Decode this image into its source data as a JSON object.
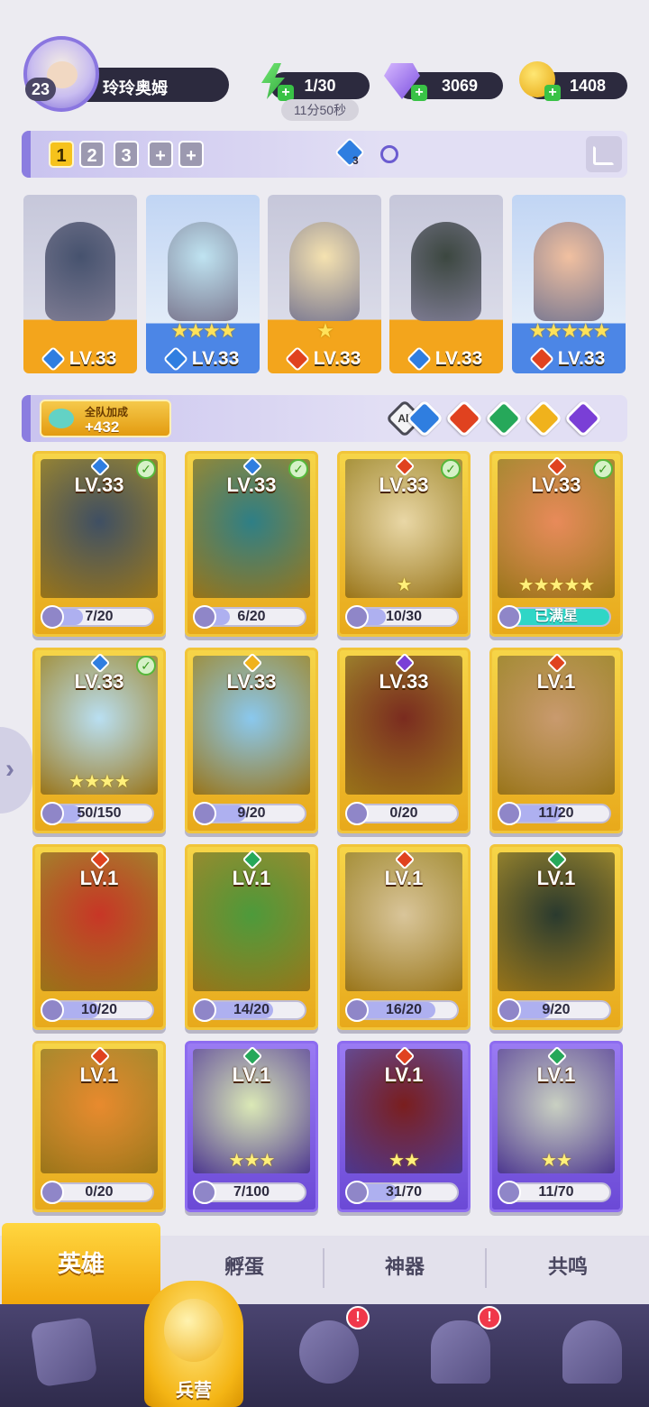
{
  "player": {
    "level": "23",
    "name": "玲玲奥姆"
  },
  "resources": {
    "energy": "1/30",
    "energy_timer": "11分50秒",
    "gems": "3069",
    "coins": "1408"
  },
  "team_tabs": [
    "1",
    "2",
    "3",
    "+",
    "+"
  ],
  "team_gem_count": "3",
  "team": [
    {
      "level": "LV.33",
      "stars": "",
      "element": "water",
      "rarity": "legend"
    },
    {
      "level": "LV.33",
      "stars": "★★★★",
      "element": "water",
      "rarity": "rare"
    },
    {
      "level": "LV.33",
      "stars": "★",
      "element": "fire",
      "rarity": "legend"
    },
    {
      "level": "LV.33",
      "stars": "",
      "element": "water",
      "rarity": "legend"
    },
    {
      "level": "LV.33",
      "stars": "★★★★★",
      "element": "fire",
      "rarity": "rare"
    }
  ],
  "filter": {
    "bonus_label": "全队加成",
    "bonus_value": "+432",
    "all_label": "All",
    "elements": [
      "water",
      "fire",
      "wind",
      "light",
      "dark"
    ]
  },
  "heroes": [
    {
      "level": "LV.33",
      "progress": "7/20",
      "frac": 0.35,
      "element": "water",
      "checked": true,
      "stars": "",
      "rarity": "legend"
    },
    {
      "level": "LV.33",
      "progress": "6/20",
      "frac": 0.3,
      "element": "water",
      "checked": true,
      "stars": "",
      "rarity": "legend"
    },
    {
      "level": "LV.33",
      "progress": "10/30",
      "frac": 0.33,
      "element": "fire",
      "checked": true,
      "stars": "★",
      "rarity": "legend"
    },
    {
      "level": "LV.33",
      "progress": "已满星",
      "frac": 1,
      "element": "fire",
      "checked": true,
      "stars": "★★★★★",
      "rarity": "legend"
    },
    {
      "level": "LV.33",
      "progress": "50/150",
      "frac": 0.33,
      "element": "water",
      "checked": true,
      "stars": "★★★★",
      "rarity": "legend"
    },
    {
      "level": "LV.33",
      "progress": "9/20",
      "frac": 0.45,
      "element": "light",
      "checked": false,
      "stars": "",
      "rarity": "legend"
    },
    {
      "level": "LV.33",
      "progress": "0/20",
      "frac": 0,
      "element": "dark",
      "checked": false,
      "stars": "",
      "rarity": "legend"
    },
    {
      "level": "LV.1",
      "progress": "11/20",
      "frac": 0.55,
      "element": "fire",
      "checked": false,
      "stars": "",
      "rarity": "legend"
    },
    {
      "level": "LV.1",
      "progress": "10/20",
      "frac": 0.5,
      "element": "fire",
      "checked": false,
      "stars": "",
      "rarity": "legend"
    },
    {
      "level": "LV.1",
      "progress": "14/20",
      "frac": 0.7,
      "element": "wind",
      "checked": false,
      "stars": "",
      "rarity": "legend"
    },
    {
      "level": "LV.1",
      "progress": "16/20",
      "frac": 0.8,
      "element": "fire",
      "checked": false,
      "stars": "",
      "rarity": "legend"
    },
    {
      "level": "LV.1",
      "progress": "9/20",
      "frac": 0.45,
      "element": "wind",
      "checked": false,
      "stars": "",
      "rarity": "legend"
    },
    {
      "level": "LV.1",
      "progress": "0/20",
      "frac": 0,
      "element": "fire",
      "checked": false,
      "stars": "",
      "rarity": "legend"
    },
    {
      "level": "LV.1",
      "progress": "7/100",
      "frac": 0.07,
      "element": "wind",
      "checked": false,
      "stars": "★★★",
      "rarity": "epic"
    },
    {
      "level": "LV.1",
      "progress": "31/70",
      "frac": 0.44,
      "element": "fire",
      "checked": false,
      "stars": "★★",
      "rarity": "epic"
    },
    {
      "level": "LV.1",
      "progress": "11/70",
      "frac": 0.16,
      "element": "wind",
      "checked": false,
      "stars": "★★",
      "rarity": "epic"
    }
  ],
  "subtabs": [
    "英雄",
    "孵蛋",
    "神器",
    "共鸣"
  ],
  "nav": {
    "active_label": "兵营",
    "badge": "!"
  },
  "colors": {
    "water": "#2f7ee0",
    "fire": "#e0421f",
    "wind": "#26a85a",
    "light": "#f0b21c",
    "dark": "#7a3fd6",
    "accent": "#f6c21c"
  }
}
